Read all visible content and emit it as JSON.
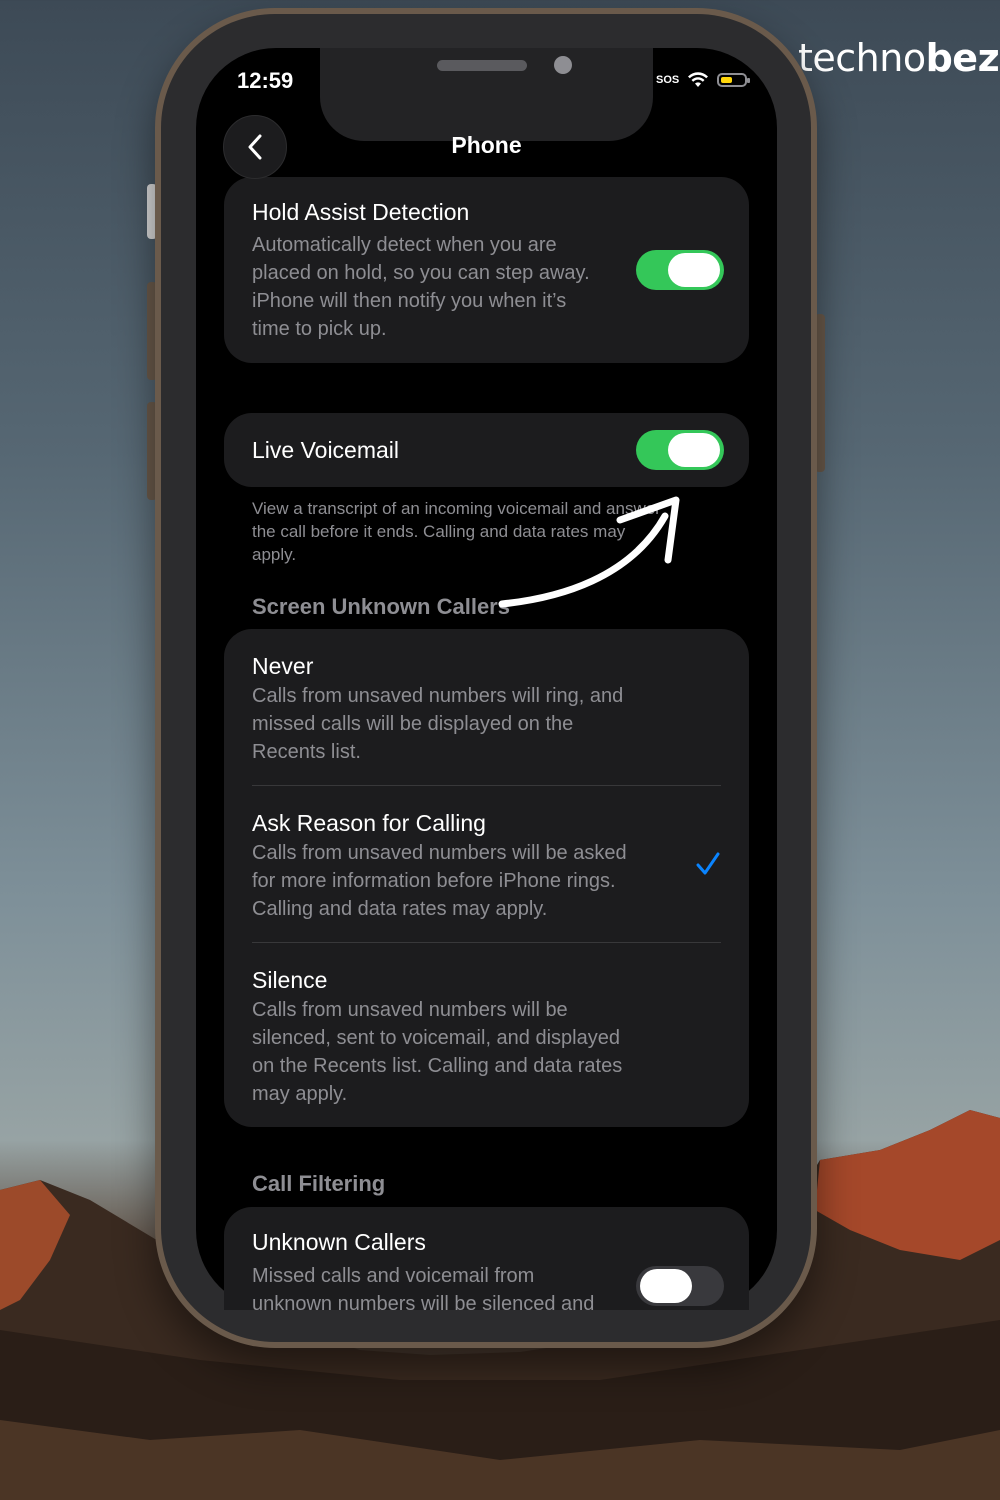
{
  "brand": {
    "light": "techno",
    "bold": "bezz"
  },
  "status": {
    "time": "12:59",
    "signal": "SOS",
    "battery_level": 0.5,
    "battery_color": "#ffd60a"
  },
  "nav": {
    "title": "Phone",
    "back_icon": "chevron-left-icon"
  },
  "hold_assist": {
    "title": "Hold Assist Detection",
    "desc_lines": [
      "Automatically detect when you are",
      "placed on hold, so you can step away.",
      "iPhone will then notify you when it’s",
      "time to pick up."
    ],
    "enabled": true
  },
  "live_voicemail": {
    "title": "Live Voicemail",
    "enabled": true,
    "footnote_lines": [
      "View a transcript of an incoming voicemail and answer",
      "the call before it ends. Calling and data rates may",
      "apply."
    ]
  },
  "screen_unknown": {
    "header": "Screen Unknown Callers",
    "options": [
      {
        "title": "Never",
        "desc_lines": [
          "Calls from unsaved numbers will ring, and",
          "missed calls will be displayed on the",
          "Recents list."
        ],
        "selected": false
      },
      {
        "title": "Ask Reason for Calling",
        "desc_lines": [
          "Calls from unsaved numbers will be asked",
          "for more information before iPhone rings.",
          "Calling and data rates may apply."
        ],
        "selected": true
      },
      {
        "title": "Silence",
        "desc_lines": [
          "Calls from unsaved numbers will be",
          "silenced, sent to voicemail, and displayed",
          "on the Recents list. Calling and data rates",
          "may apply."
        ],
        "selected": false
      }
    ]
  },
  "call_filtering": {
    "header": "Call Filtering",
    "unknown_callers": {
      "title": "Unknown Callers",
      "desc_lines": [
        "Missed calls and voicemail from",
        "unknown numbers will be silenced and"
      ],
      "enabled": false
    }
  },
  "colors": {
    "accent": "#0a84ff",
    "toggle_on": "#34c759",
    "card": "#1c1c1e"
  }
}
